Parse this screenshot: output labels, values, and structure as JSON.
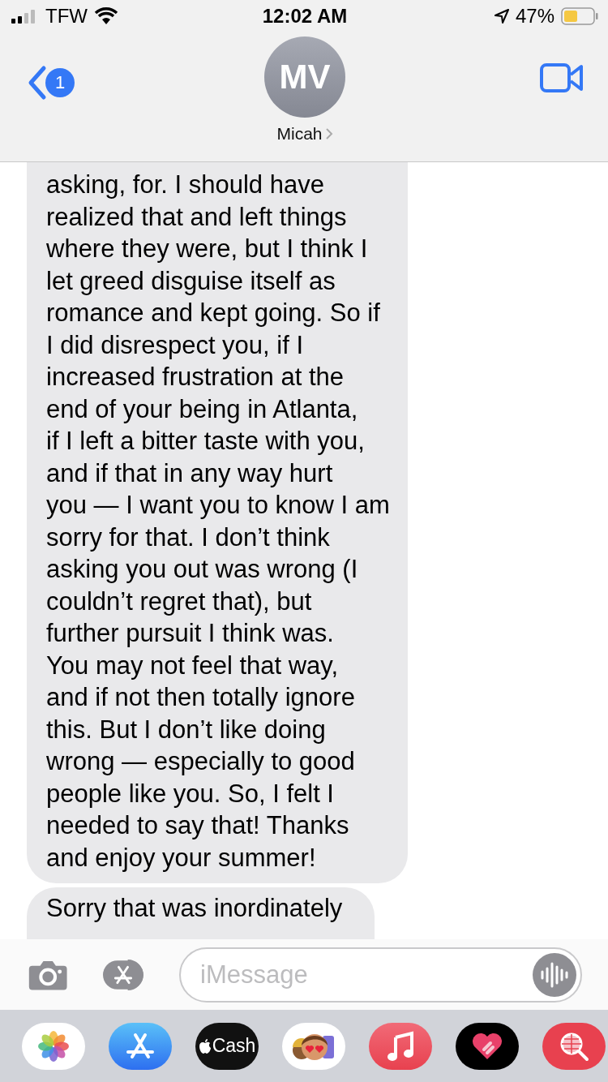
{
  "status_bar": {
    "carrier": "TFW",
    "time": "12:02 AM",
    "battery": "47%"
  },
  "header": {
    "back_badge": "1",
    "avatar_initials": "MV",
    "contact_name": "Micah"
  },
  "messages": [
    {
      "kind": "received",
      "text": "asking, for. I should have\nrealized that and left things\nwhere they were, but I think I\nlet greed disguise itself as\nromance and kept going. So if\nI did disrespect you, if I\nincreased frustration at the\nend of your being in Atlanta,\nif I left a bitter taste with you,\nand if that in any way hurt\nyou — I want you to know I am\nsorry for that. I don’t think\nasking you out was wrong (I\ncouldn’t regret that), but\nfurther pursuit I think was.\nYou may not feel that way,\nand if not then totally ignore\nthis. But I don’t like doing\nwrong — especially to good\npeople like you. So, I felt I\nneeded to say that! Thanks\nand enjoy your summer!"
    },
    {
      "kind": "received",
      "text": "Sorry that was inordinately"
    }
  ],
  "input": {
    "placeholder": "iMessage"
  },
  "app_drawer": [
    {
      "kind": "photos"
    },
    {
      "kind": "appstore"
    },
    {
      "kind": "cash",
      "label": "Cash"
    },
    {
      "kind": "memoji"
    },
    {
      "kind": "music"
    },
    {
      "kind": "fitness"
    },
    {
      "kind": "images"
    }
  ]
}
